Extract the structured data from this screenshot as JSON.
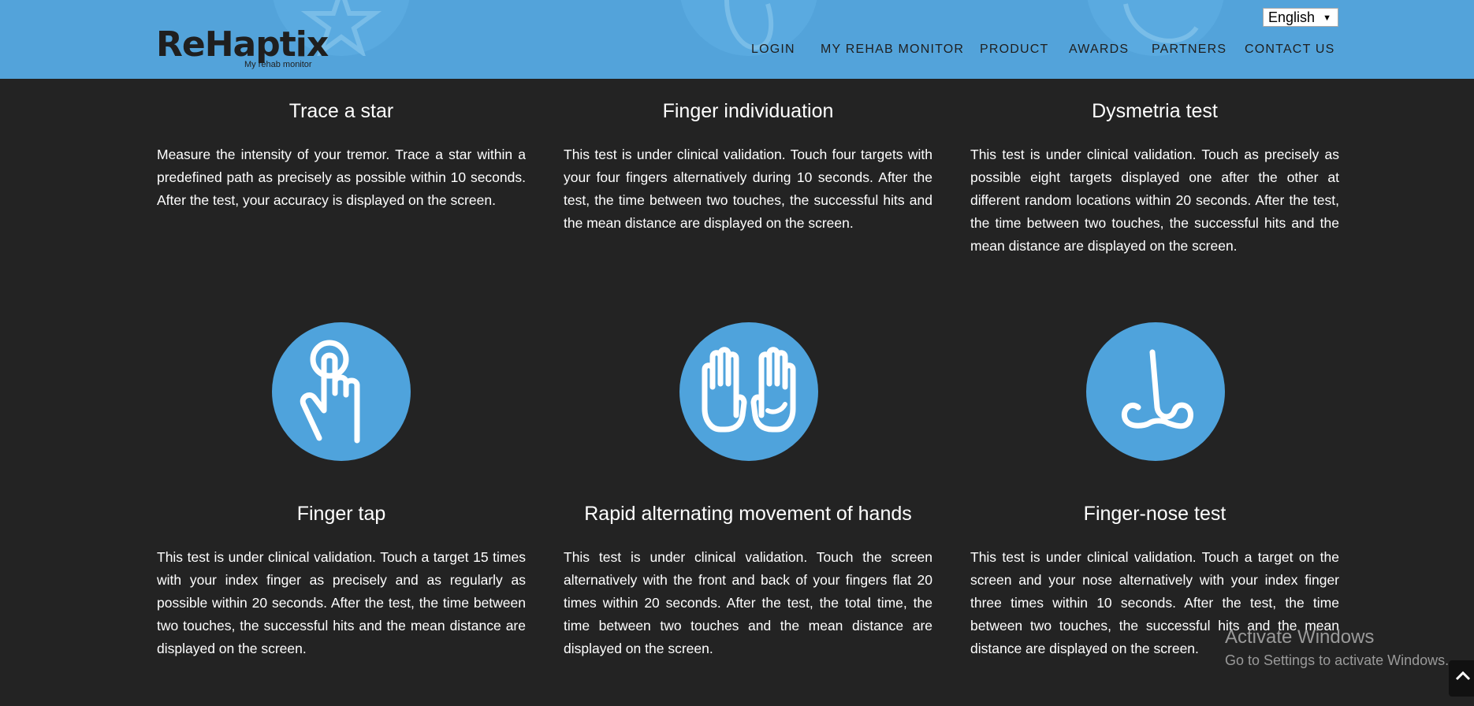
{
  "header": {
    "logo_main": "ReHaptix",
    "logo_sub": "My rehab monitor",
    "language": "English",
    "nav": [
      "LOGIN",
      "MY REHAB MONITOR",
      "PRODUCT",
      "AWARDS",
      "PARTNERS",
      "CONTACT US"
    ]
  },
  "tests_top": [
    {
      "title": "Trace a star",
      "description": "Measure the intensity of your tremor. Trace a star within a predefined path as precisely as possible within 10 seconds. After the test, your accuracy is displayed on the screen."
    },
    {
      "title": "Finger individuation",
      "description": "This test is under clinical validation. Touch four targets with your four fingers alternatively during 10 seconds. After the test, the time between two touches, the successful hits and the mean distance are displayed on the screen."
    },
    {
      "title": "Dysmetria test",
      "description": "This test is under clinical validation. Touch as precisely as possible eight targets displayed one after the other at different random locations within 20 seconds. After the test, the time between two touches, the successful hits and the mean distance are displayed on the screen."
    }
  ],
  "tests_bottom": [
    {
      "title": "Finger tap",
      "icon": "finger-tap-icon",
      "description": "This test is under clinical validation. Touch a target 15 times with your index finger as precisely and as regularly as possible within 20 seconds. After the test, the time between two touches, the successful hits and the mean distance are displayed on the screen."
    },
    {
      "title": "Rapid alternating movement of hands",
      "icon": "hands-icon",
      "description": "This test is under clinical validation. Touch the screen alternatively with the front and back of your fingers flat 20 times within 20 seconds. After the test, the total time, the time between two touches and the mean distance are displayed on the screen."
    },
    {
      "title": "Finger-nose test",
      "icon": "nose-icon",
      "description": "This test is under clinical validation. Touch a target on the screen and your nose alternatively with your index finger three times within 10 seconds. After the test, the time between two touches, the successful hits and the mean distance are displayed on the screen."
    }
  ],
  "watermark": {
    "line1": "Activate Windows",
    "line2": "Go to Settings to activate Windows."
  },
  "colors": {
    "header": "#53a3da",
    "circle": "#4fa3dc",
    "background": "#232323"
  }
}
